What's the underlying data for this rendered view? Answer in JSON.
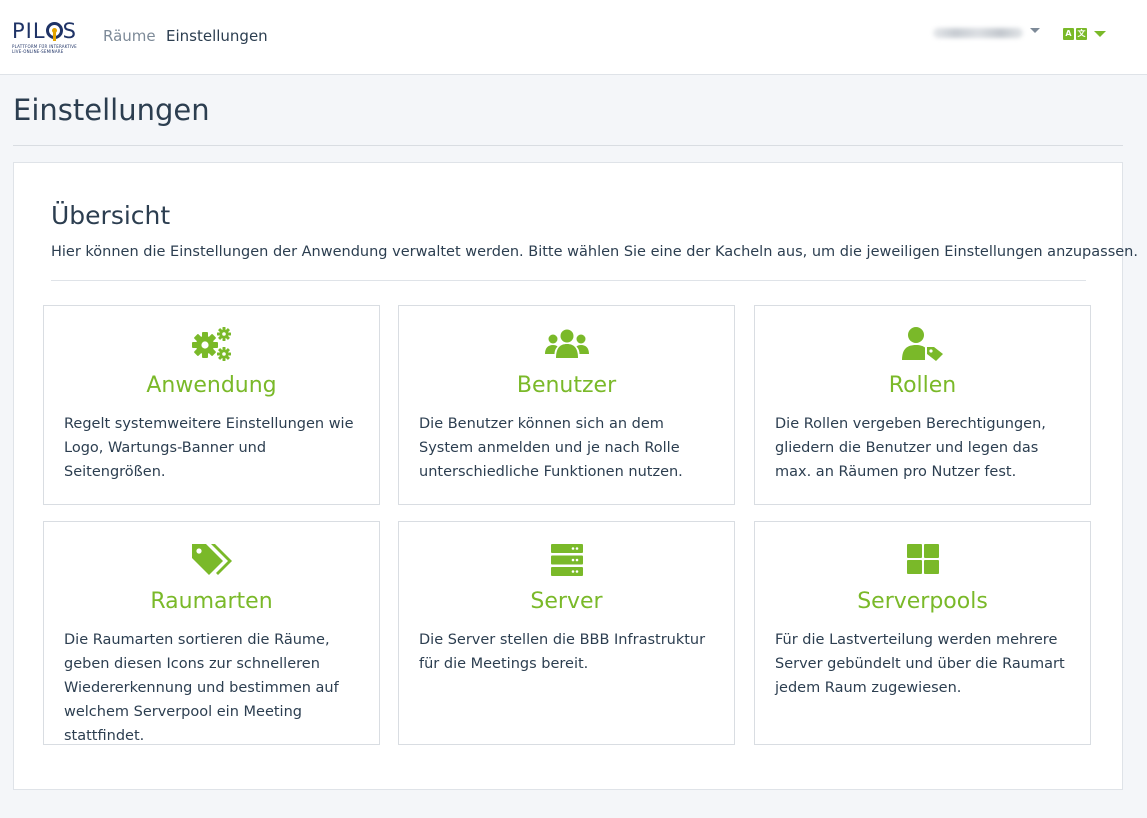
{
  "navbar": {
    "logo": {
      "word": "PILOS",
      "subtitle_line1": "PLATTFORM FÜR INTERAKTIVE",
      "subtitle_line2": "LIVE-ONLINE-SEMINARE"
    },
    "links": [
      {
        "label": "Räume"
      },
      {
        "label": "Einstellungen"
      }
    ],
    "language_badge": {
      "left": "A",
      "right": "文"
    }
  },
  "page": {
    "title": "Einstellungen"
  },
  "overview": {
    "title": "Übersicht",
    "description": "Hier können die Einstellungen der Anwendung verwaltet werden. Bitte wählen Sie eine der Kacheln aus, um die jeweiligen Einstellungen anzupassen."
  },
  "accent_color": "#7ab929",
  "tiles": [
    {
      "icon": "cogs-icon",
      "title": "Anwendung",
      "text": "Regelt systemweitere Einstellungen wie Logo, Wartungs-Banner und Seitengrößen."
    },
    {
      "icon": "users-icon",
      "title": "Benutzer",
      "text": "Die Benutzer können sich an dem System anmelden und je nach Rolle unterschiedliche Funktionen nutzen."
    },
    {
      "icon": "user-tag-icon",
      "title": "Rollen",
      "text": "Die Rollen vergeben Berechtigungen, gliedern die Benutzer und legen das max. an Räumen pro Nutzer fest."
    },
    {
      "icon": "tags-icon",
      "title": "Raumarten",
      "text": "Die Raumarten sortieren die Räume, geben diesen Icons zur schnelleren Wiedererkennung und bestimmen auf welchem Serverpool ein Meeting stattfindet."
    },
    {
      "icon": "server-icon",
      "title": "Server",
      "text": "Die Server stellen die BBB Infrastruktur für die Meetings bereit."
    },
    {
      "icon": "th-large-icon",
      "title": "Serverpools",
      "text": "Für die Lastverteilung werden mehrere Server gebündelt und über die Raumart jedem Raum zugewiesen."
    }
  ]
}
